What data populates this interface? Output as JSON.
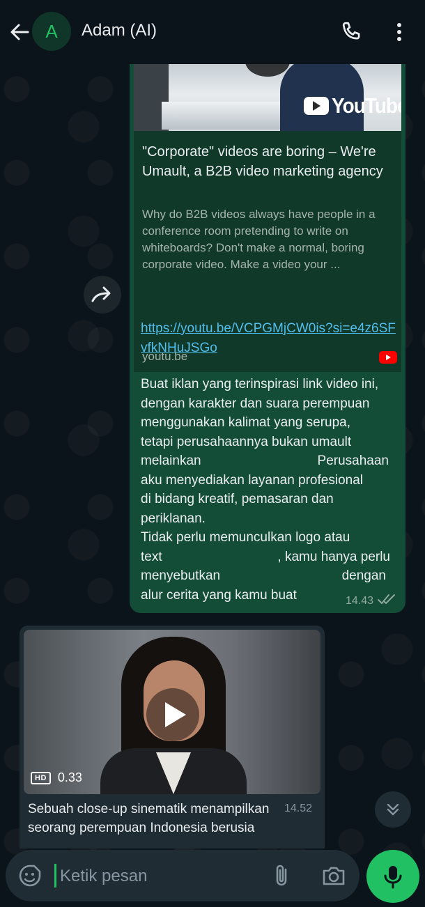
{
  "header": {
    "avatar_letter": "A",
    "contact_name": "Adam (AI)"
  },
  "outgoing": {
    "preview_brand": "YouTube",
    "preview_title": "\"Corporate\" videos are boring – We're Umault, a B2B video marketing agency",
    "preview_desc": "Why do B2B videos always have people in a conference room pretending to write on whiteboards? Don't make a normal, boring corporate video. Make a video your ...",
    "preview_domain": "youtu.be",
    "link": "https://youtu.be/VCPGMjCW0is?si=e4z6SFvfkNHuJSGo",
    "message_lines": [
      "Buat iklan yang terinspirasi link video ini,",
      "dengan karakter dan suara perempuan",
      "menggunakan kalimat yang serupa,",
      "tetapi perusahaannya bukan umault",
      "melainkan",
      "Perusahaan",
      "aku menyediakan layanan profesional",
      "di bidang kreatif, pemasaran dan",
      "periklanan.",
      "Tidak perlu memunculkan logo atau",
      "text",
      ", kamu hanya perlu",
      "menyebutkan",
      "dengan",
      "alur cerita yang kamu buat"
    ],
    "time": "14.43"
  },
  "incoming": {
    "video_quality": "HD",
    "video_duration": "0.33",
    "caption": "Sebuah close-up sinematik menampilkan seorang perempuan Indonesia berusia",
    "time": "14.52"
  },
  "composer": {
    "placeholder": "Ketik pesan"
  },
  "colors": {
    "accent": "#21c063",
    "outgoing_bubble": "#144d37",
    "incoming_bubble": "#1f2c34",
    "link": "#53bdeb",
    "background": "#0b141a"
  },
  "icons": {
    "back": "arrow-left-icon",
    "call": "phone-icon",
    "menu": "more-vertical-icon",
    "forward": "forward-icon",
    "read_receipt": "double-check-icon",
    "scroll": "chevron-double-down-icon",
    "emoji": "sticker-icon",
    "attach": "paperclip-icon",
    "camera": "camera-icon",
    "mic": "microphone-icon"
  }
}
